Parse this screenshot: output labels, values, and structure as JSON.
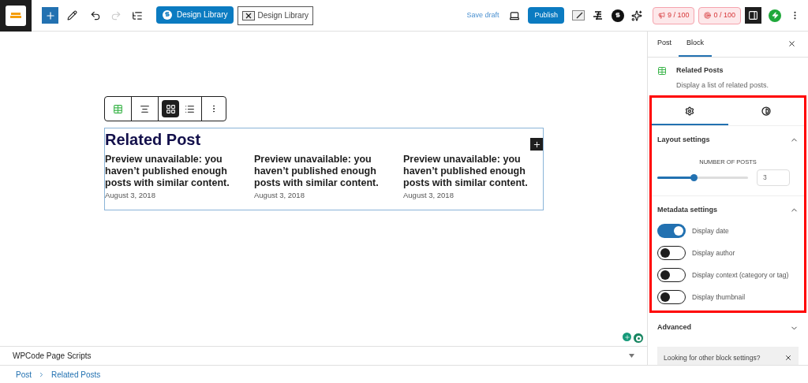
{
  "toolbar": {
    "undo": {
      "disabled": false
    },
    "redo": {
      "disabled": true
    },
    "library_buttons": [
      {
        "label": "Design Library",
        "kind": "primary"
      },
      {
        "label": "Design Library",
        "kind": "outline"
      }
    ],
    "save_draft": "Save draft",
    "publish": "Publish",
    "scores": [
      {
        "label": "9 / 100",
        "kind": "seo"
      },
      {
        "label": "0 / 100",
        "kind": "readability"
      }
    ],
    "settings_toggle": {
      "selected": true
    }
  },
  "block_toolbar": {
    "views": [
      {
        "kind": "grid",
        "selected": true
      },
      {
        "kind": "list",
        "selected": false
      }
    ]
  },
  "block": {
    "title": "Related Post",
    "posts": [
      {
        "title": "Preview unavailable: you haven’t published enough posts with similar content.",
        "date": "August 3, 2018"
      },
      {
        "title": "Preview unavailable: you haven’t published enough posts with similar content.",
        "date": "August 3, 2018"
      },
      {
        "title": "Preview unavailable: you haven’t published enough posts with similar content.",
        "date": "August 3, 2018"
      }
    ]
  },
  "sidebar": {
    "tabs": [
      {
        "label": "Post",
        "selected": false
      },
      {
        "label": "Block",
        "selected": true
      }
    ],
    "block_card": {
      "title": "Related Posts",
      "description": "Display a list of related posts."
    },
    "icon_tabs": [
      {
        "kind": "settings",
        "selected": true
      },
      {
        "kind": "styles",
        "selected": false
      }
    ],
    "layout": {
      "title": "Layout settings",
      "expanded": true,
      "slider": {
        "label": "NUMBER OF POSTS",
        "level": 0.4,
        "value": "3"
      }
    },
    "metadata": {
      "title": "Metadata settings",
      "expanded": true,
      "toggles": [
        {
          "label": "Display date",
          "on": true
        },
        {
          "label": "Display author",
          "on": false
        },
        {
          "label": "Display context (category or tag)",
          "on": false
        },
        {
          "label": "Display thumbnail",
          "on": false
        }
      ]
    },
    "advanced": {
      "title": "Advanced",
      "expanded": false
    },
    "notice": "Looking for other block settings?"
  },
  "footer_panel": {
    "title": "WPCode Page Scripts"
  },
  "breadcrumb": [
    "Post",
    "Related Posts"
  ]
}
